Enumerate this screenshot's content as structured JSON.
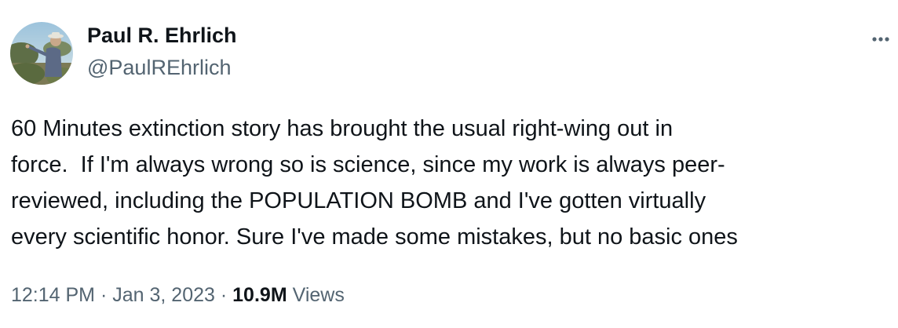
{
  "author": {
    "display_name": "Paul R. Ehrlich",
    "handle": "@PaulREhrlich"
  },
  "menu": {
    "icon": "more-horizontal-icon"
  },
  "tweet": {
    "lines": [
      "60 Minutes extinction story has brought the usual right-wing out in",
      "force.  If I'm always wrong so is science, since my work is always peer-",
      "reviewed, including the POPULATION BOMB and I've gotten virtually",
      "every scientific honor. Sure I've made some mistakes, but no basic ones"
    ]
  },
  "meta": {
    "time": "12:14 PM",
    "separator": "·",
    "date": "Jan 3, 2023",
    "views_count": "10.9M",
    "views_label": "Views"
  },
  "colors": {
    "primary_text": "#0f1419",
    "secondary_text": "#536471"
  }
}
